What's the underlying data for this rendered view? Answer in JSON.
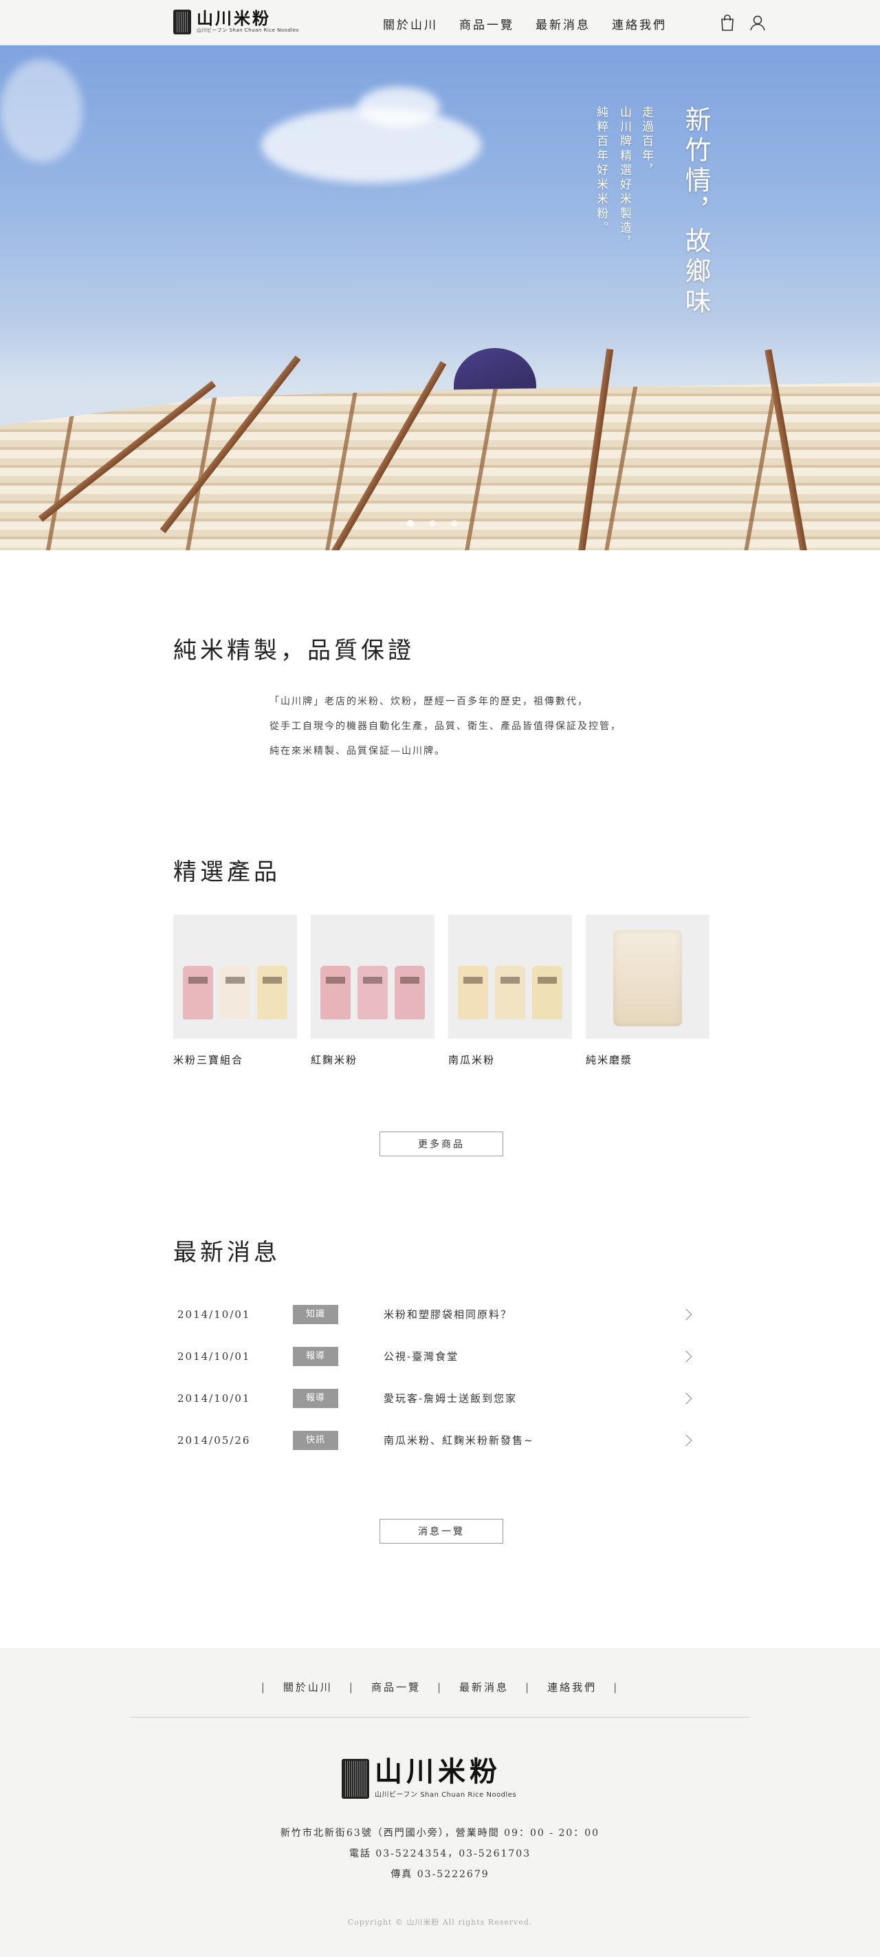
{
  "header": {
    "logo_cn": "山川米粉",
    "logo_sub": "山川ビーフン  Shan Chuan Rice Noodles",
    "nav": [
      "關於山川",
      "商品一覽",
      "最新消息",
      "連絡我們"
    ]
  },
  "hero": {
    "title": "新竹情，故鄉味",
    "sub_lines": [
      "走過百年，",
      "山川牌精選好米製造，",
      "純粹百年好米米粉。"
    ]
  },
  "intro": {
    "title": "純米精製，品質保證",
    "lines": [
      "「山川牌」老店的米粉、炊粉，歷經一百多年的歷史，祖傳數代，",
      "從手工自現今的機器自動化生產，品質、衛生、產品皆值得保証及控管，",
      "純在來米精製、品質保証—山川牌。"
    ]
  },
  "products": {
    "title": "精選產品",
    "items": [
      {
        "name": "米粉三寶組合"
      },
      {
        "name": "紅麴米粉"
      },
      {
        "name": "南瓜米粉"
      },
      {
        "name": "純米磨漿"
      }
    ],
    "more_button": "更多商品"
  },
  "news": {
    "title": "最新消息",
    "items": [
      {
        "date": "2014/10/01",
        "tag": "知識",
        "title": "米粉和塑膠袋相同原料？"
      },
      {
        "date": "2014/10/01",
        "tag": "報導",
        "title": "公視-臺灣食堂"
      },
      {
        "date": "2014/10/01",
        "tag": "報導",
        "title": "愛玩客-詹姆士送飯到您家"
      },
      {
        "date": "2014/05/26",
        "tag": "快訊",
        "title": "南瓜米粉、紅麴米粉新發售~"
      }
    ],
    "more_button": "消息一覽"
  },
  "footer": {
    "nav": [
      "關於山川",
      "商品一覽",
      "最新消息",
      "連絡我們"
    ],
    "logo_cn": "山川米粉",
    "logo_sub": "山川ビーフン   Shan Chuan Rice Noodles",
    "address": "新竹市北新街63號（西門國小旁），營業時間 09：00 - 20：00",
    "phone": "電話  03-5224354，03-5261703",
    "fax": "傳真  03-5222679",
    "copyright": "Copyright © 山川米粉 All rights Reserved."
  }
}
